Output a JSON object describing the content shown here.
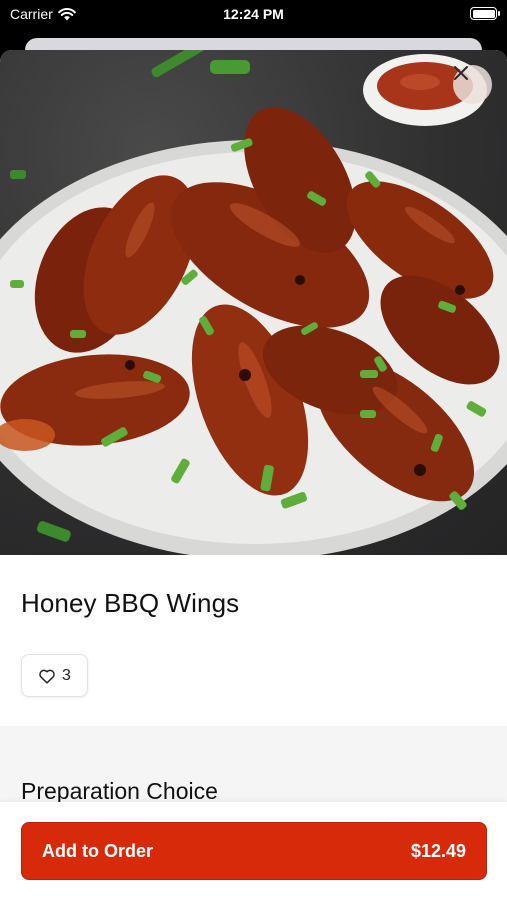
{
  "status_bar": {
    "carrier": "Carrier",
    "time": "12:24 PM"
  },
  "item": {
    "name": "Honey BBQ Wings",
    "like_count": "3",
    "image_subject": "honey bbq wings on plate"
  },
  "options": {
    "section_title": "Preparation Choice"
  },
  "cta": {
    "label": "Add to Order",
    "price": "$12.49"
  },
  "colors": {
    "accent": "#d62a0b",
    "sauce": "#8a2a0c",
    "chive": "#5aa63a"
  },
  "icons": {
    "close": "close-icon",
    "like": "heart-icon",
    "wifi": "wifi-icon",
    "battery": "battery-icon"
  }
}
